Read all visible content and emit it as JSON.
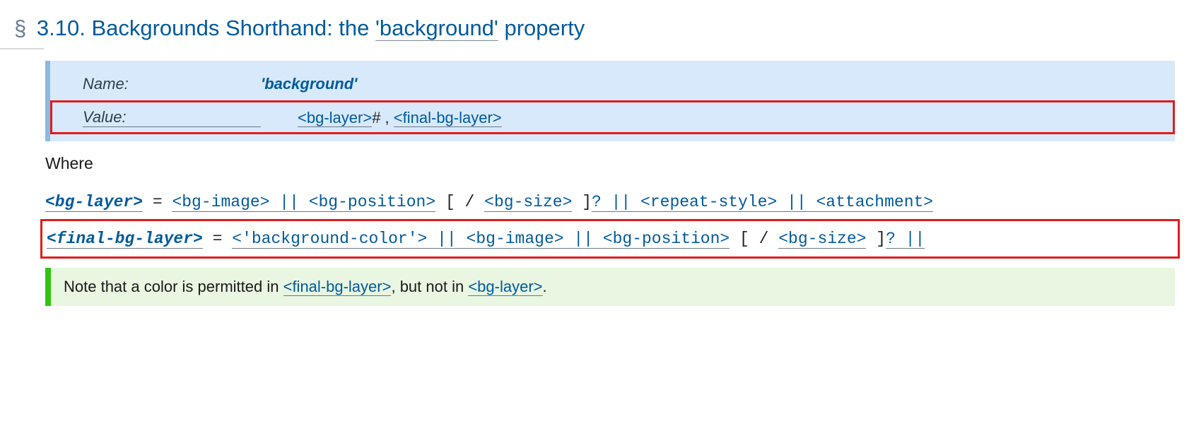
{
  "heading": {
    "section_mark": "§",
    "number": "3.10.",
    "title_pre": "Backgrounds Shorthand: the ",
    "quoted": "'background'",
    "title_post": " property"
  },
  "propdef": {
    "name_label": "Name:",
    "name_value": "'background'",
    "value_label": "Value:",
    "value": {
      "bg_layer": "<bg-layer>",
      "hash": "#",
      "sep": " , ",
      "final": "<final-bg-layer>"
    }
  },
  "where": "Where",
  "grammar": {
    "bg_layer": {
      "head": "<bg-layer>",
      "eq": " = ",
      "t1": "<bg-image>",
      "op": " || ",
      "t2": "<bg-position>",
      "br_open": " [ / ",
      "t3": "<bg-size>",
      "br_close": " ]",
      "opt": "?",
      "t4": "<repeat-style>",
      "t5": "<attachment>"
    },
    "final": {
      "head": "<final-bg-layer>",
      "eq": " =  ",
      "t1": "<'background-color'>",
      "op": " || ",
      "t2": "<bg-image>",
      "t3": "<bg-position>",
      "br_open": " [ / ",
      "t4": "<bg-size>",
      "br_close": " ]",
      "opt": "?",
      "trail": " || "
    }
  },
  "note": {
    "pre": "Note that a color is permitted in ",
    "link1": "<final-bg-layer>",
    "mid": ", but not in ",
    "link2": "<bg-layer>",
    "post": "."
  }
}
